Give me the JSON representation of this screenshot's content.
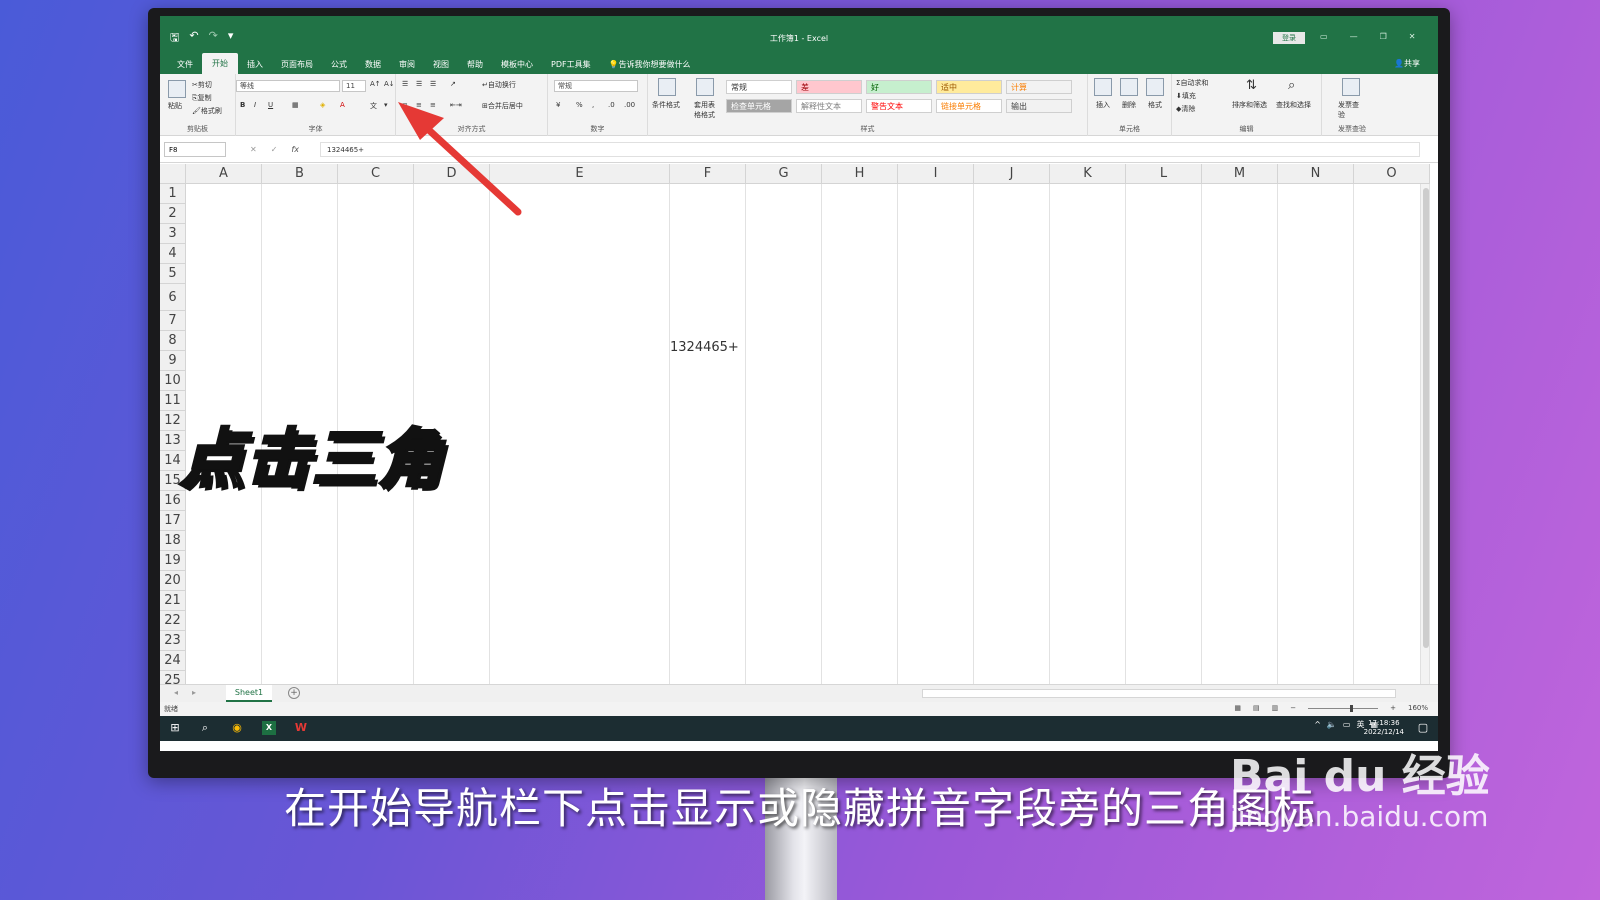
{
  "window": {
    "title": "工作簿1 - Excel",
    "login_label": "登录",
    "share_label": "共享"
  },
  "qat": [
    "save-icon",
    "undo-icon",
    "redo-icon",
    "customize-icon"
  ],
  "tabs": [
    "文件",
    "开始",
    "插入",
    "页面布局",
    "公式",
    "数据",
    "审阅",
    "视图",
    "帮助",
    "模板中心",
    "PDF工具集",
    "告诉我你想要做什么"
  ],
  "active_tab": "开始",
  "ribbon": {
    "clipboard": {
      "label": "剪贴板",
      "paste": "粘贴",
      "cut": "剪切",
      "copy": "复制",
      "format_painter": "格式刷"
    },
    "font": {
      "label": "字体",
      "font_name": "等线",
      "font_size": "11",
      "bold": "B",
      "italic": "I",
      "underline": "U"
    },
    "alignment": {
      "label": "对齐方式",
      "wrap": "自动换行",
      "merge": "合并后居中"
    },
    "number": {
      "label": "数字",
      "format": "常规",
      "percent": "%"
    },
    "styles": {
      "label": "样式",
      "conditional": "条件格式",
      "table": "套用表格格式",
      "cells": [
        {
          "text": "常规",
          "bg": "#ffffff",
          "color": "#333333"
        },
        {
          "text": "差",
          "bg": "#ffc7ce",
          "color": "#9c0006"
        },
        {
          "text": "好",
          "bg": "#c6efce",
          "color": "#006100"
        },
        {
          "text": "适中",
          "bg": "#ffeb9c",
          "color": "#9c5700"
        },
        {
          "text": "计算",
          "bg": "#f2f2f2",
          "color": "#fa7d00"
        },
        {
          "text": "检查单元格",
          "bg": "#a5a5a5",
          "color": "#ffffff"
        },
        {
          "text": "解释性文本",
          "bg": "#ffffff",
          "color": "#7f7f7f"
        },
        {
          "text": "警告文本",
          "bg": "#ffffff",
          "color": "#ff0000"
        },
        {
          "text": "链接单元格",
          "bg": "#ffffff",
          "color": "#fa7d00"
        },
        {
          "text": "输出",
          "bg": "#f2f2f2",
          "color": "#3f3f3f"
        }
      ]
    },
    "cells_group": {
      "label": "单元格",
      "insert": "插入",
      "delete": "删除",
      "format": "格式"
    },
    "editing": {
      "label": "编辑",
      "autosum": "自动求和",
      "fill": "填充",
      "clear": "清除",
      "sort": "排序和筛选",
      "find": "查找和选择"
    },
    "invoice": {
      "label": "发票查验",
      "button": "发票查验"
    }
  },
  "formula_bar": {
    "name_box": "F8",
    "value": "1324465+"
  },
  "grid": {
    "columns": [
      "A",
      "B",
      "C",
      "D",
      "E",
      "F",
      "G",
      "H",
      "I",
      "J",
      "K",
      "L",
      "M",
      "N",
      "O"
    ],
    "rows": [
      "1",
      "2",
      "3",
      "4",
      "5",
      "6",
      "7",
      "8",
      "9",
      "10",
      "11",
      "12",
      "13",
      "14",
      "15",
      "16",
      "17",
      "18",
      "19",
      "20",
      "21",
      "22",
      "23",
      "24",
      "25"
    ],
    "cell_f8": "1324465+"
  },
  "sheet": {
    "tab": "Sheet1",
    "add": "+"
  },
  "status": {
    "ready": "就绪",
    "zoom": "160%"
  },
  "taskbar": {
    "time": "17:18:36",
    "date": "2022/12/14",
    "lang": "英"
  },
  "overlay": {
    "title": "点击三角",
    "subtitle": "在开始导航栏下点击显示或隐藏拼音字段旁的三角图标",
    "watermark_logo": "Bai du 经验",
    "watermark_url": "jingyan.baidu.com"
  },
  "colors": {
    "excel_green": "#217346",
    "arrow_red": "#e53935"
  }
}
